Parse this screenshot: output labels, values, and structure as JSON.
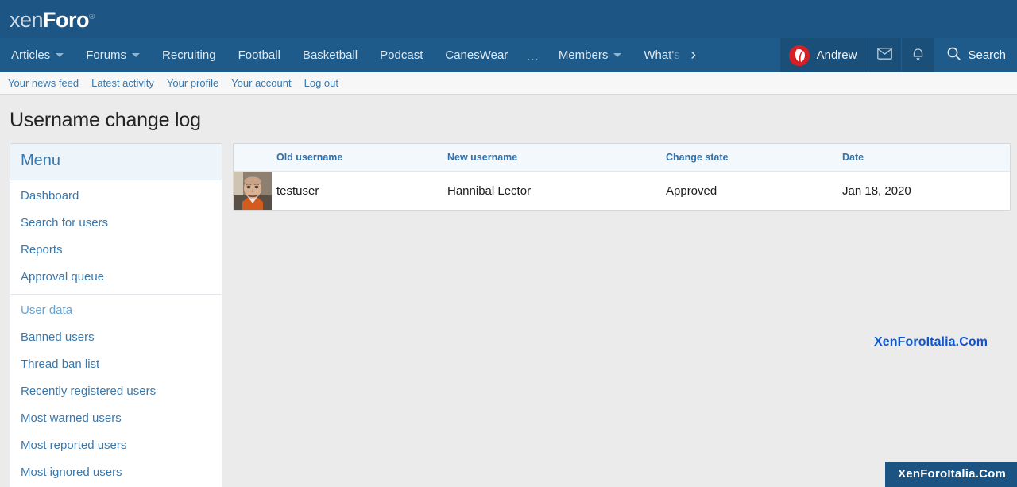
{
  "site": {
    "logo_xen": "xen",
    "logo_foro": "Foro",
    "logo_reg": "®"
  },
  "nav": {
    "items": [
      {
        "label": "Articles",
        "has_dropdown": true
      },
      {
        "label": "Forums",
        "has_dropdown": true
      },
      {
        "label": "Recruiting",
        "has_dropdown": false
      },
      {
        "label": "Football",
        "has_dropdown": false
      },
      {
        "label": "Basketball",
        "has_dropdown": false
      },
      {
        "label": "Podcast",
        "has_dropdown": false
      },
      {
        "label": "CanesWear",
        "has_dropdown": false
      }
    ],
    "overflow_label": "...",
    "members_label": "Members",
    "whats_new_label": "What's",
    "scroll_arrow": "›"
  },
  "user": {
    "name": "Andrew",
    "avatar_icon": "team-flame-logo",
    "inbox_icon": "envelope-icon",
    "alerts_icon": "bell-icon"
  },
  "search": {
    "label": "Search",
    "icon": "search-icon"
  },
  "subnav": {
    "items": [
      "Your news feed",
      "Latest activity",
      "Your profile",
      "Your account",
      "Log out"
    ]
  },
  "page": {
    "title": "Username change log"
  },
  "sidebar": {
    "header": "Menu",
    "groups": [
      {
        "section_title": null,
        "items": [
          "Dashboard",
          "Search for users",
          "Reports",
          "Approval queue"
        ]
      },
      {
        "section_title": "User data",
        "items": [
          "Banned users",
          "Thread ban list",
          "Recently registered users",
          "Most warned users",
          "Most reported users",
          "Most ignored users"
        ]
      }
    ]
  },
  "table": {
    "columns": [
      "Old username",
      "New username",
      "Change state",
      "Date"
    ],
    "rows": [
      {
        "avatar": "user-photo-testuser",
        "old_username": "testuser",
        "new_username": "Hannibal Lector",
        "change_state": "Approved",
        "date": "Jan 18, 2020"
      }
    ]
  },
  "watermarks": {
    "text": "XenForoItalia.Com",
    "badge": "XenForoItalia.Com"
  },
  "colors": {
    "header_blue": "#1d5685",
    "nav_blue": "#1f5b8a",
    "user_block_blue": "#1a4f7a",
    "link_blue": "#3a78ac",
    "table_header_blue": "#2f72ad",
    "avatar_red": "#d81f26",
    "page_bg": "#ebebeb",
    "watermark_blue": "#1155cc",
    "badge_blue": "#1b5382"
  }
}
